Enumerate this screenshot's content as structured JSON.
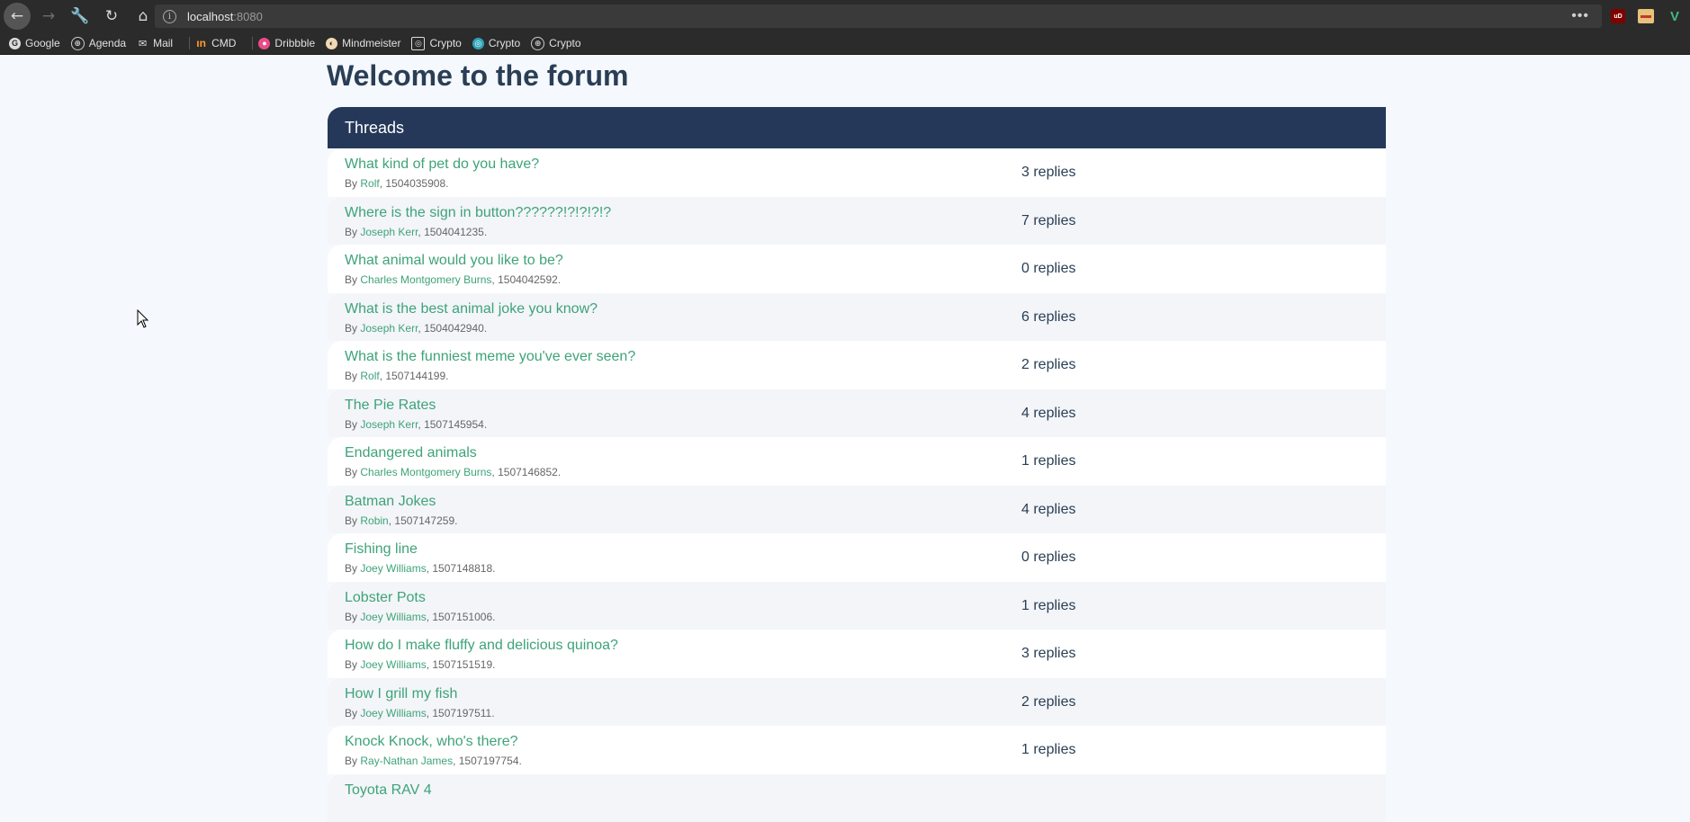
{
  "browser": {
    "url_host": "localhost",
    "url_port": ":8080",
    "more": "•••",
    "ublock_label": "uD",
    "bookmarks": [
      {
        "label": "Google",
        "icon": "google-icon"
      },
      {
        "label": "Agenda",
        "icon": "globe-icon"
      },
      {
        "label": "Mail",
        "icon": "mail-icon"
      },
      {
        "label": "CMD",
        "icon": "cmd-icon"
      },
      {
        "label": "Dribbble",
        "icon": "dribbble-icon"
      },
      {
        "label": "Mindmeister",
        "icon": "mindmeister-icon"
      },
      {
        "label": "Crypto",
        "icon": "crypto-icon"
      },
      {
        "label": "Crypto",
        "icon": "crypto-icon"
      },
      {
        "label": "Crypto",
        "icon": "globe-icon"
      }
    ]
  },
  "page": {
    "title": "Welcome to the forum",
    "threads_header": "Threads",
    "by_prefix": "By",
    "threads": [
      {
        "title": "What kind of pet do you have?",
        "author": "Rolf",
        "timestamp": "1504035908",
        "replies": "3 replies"
      },
      {
        "title": "Where is the sign in button??????!?!?!?!?",
        "author": "Joseph Kerr",
        "timestamp": "1504041235",
        "replies": "7 replies"
      },
      {
        "title": "What animal would you like to be?",
        "author": "Charles Montgomery Burns",
        "timestamp": "1504042592",
        "replies": "0 replies"
      },
      {
        "title": "What is the best animal joke you know?",
        "author": "Joseph Kerr",
        "timestamp": "1504042940",
        "replies": "6 replies"
      },
      {
        "title": "What is the funniest meme you've ever seen?",
        "author": "Rolf",
        "timestamp": "1507144199",
        "replies": "2 replies"
      },
      {
        "title": "The Pie Rates",
        "author": "Joseph Kerr",
        "timestamp": "1507145954",
        "replies": "4 replies"
      },
      {
        "title": "Endangered animals",
        "author": "Charles Montgomery Burns",
        "timestamp": "1507146852",
        "replies": "1 replies"
      },
      {
        "title": "Batman Jokes",
        "author": "Robin",
        "timestamp": "1507147259",
        "replies": "4 replies"
      },
      {
        "title": "Fishing line",
        "author": "Joey Williams",
        "timestamp": "1507148818",
        "replies": "0 replies"
      },
      {
        "title": "Lobster Pots",
        "author": "Joey Williams",
        "timestamp": "1507151006",
        "replies": "1 replies"
      },
      {
        "title": "How do I make fluffy and delicious quinoa?",
        "author": "Joey Williams",
        "timestamp": "1507151519",
        "replies": "3 replies"
      },
      {
        "title": "How I grill my fish",
        "author": "Joey Williams",
        "timestamp": "1507197511",
        "replies": "2 replies"
      },
      {
        "title": "Knock Knock, who's there?",
        "author": "Ray-Nathan James",
        "timestamp": "1507197754",
        "replies": "1 replies"
      },
      {
        "title": "Toyota RAV 4",
        "author": "",
        "timestamp": "",
        "replies": ""
      }
    ]
  }
}
